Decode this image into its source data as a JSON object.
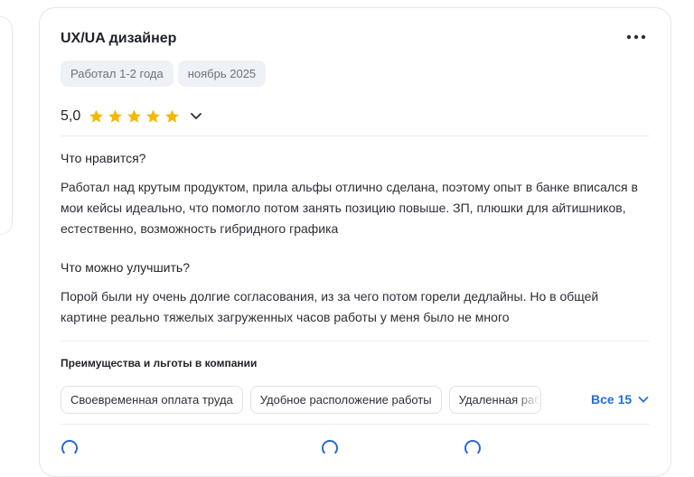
{
  "review": {
    "title": "UX/UA дизайнер",
    "tags": [
      "Работал 1-2 года",
      "ноябрь 2025"
    ],
    "rating": "5,0",
    "stars": 5,
    "likes_title": "Что нравится?",
    "likes_text": "Работал над крутым продуктом, прила альфы отлично сделана, поэтому опыт в банке вписался в мои кейсы идеально, что помогло потом занять позицию повыше. ЗП, плюшки для айтишников, естественно, возможность гибридного графика",
    "improve_title": "Что можно улучшить?",
    "improve_text": "Порой были ну очень долгие согласования, из за чего потом горели дедлайны. Но в общей картине реально тяжелых загруженных часов работы у меня было не много",
    "benefits_title": "Преимущества и льготы в компании",
    "benefits": [
      "Своевременная оплата труда",
      "Удобное расположение работы",
      "Удаленная работа"
    ],
    "all_link": "Все 15"
  },
  "colors": {
    "star": "#f5b800",
    "link": "#1f6fe5",
    "tag_bg": "#eef1f5"
  },
  "icons": [
    "more-icon",
    "star-icon",
    "chevron-down-icon"
  ]
}
